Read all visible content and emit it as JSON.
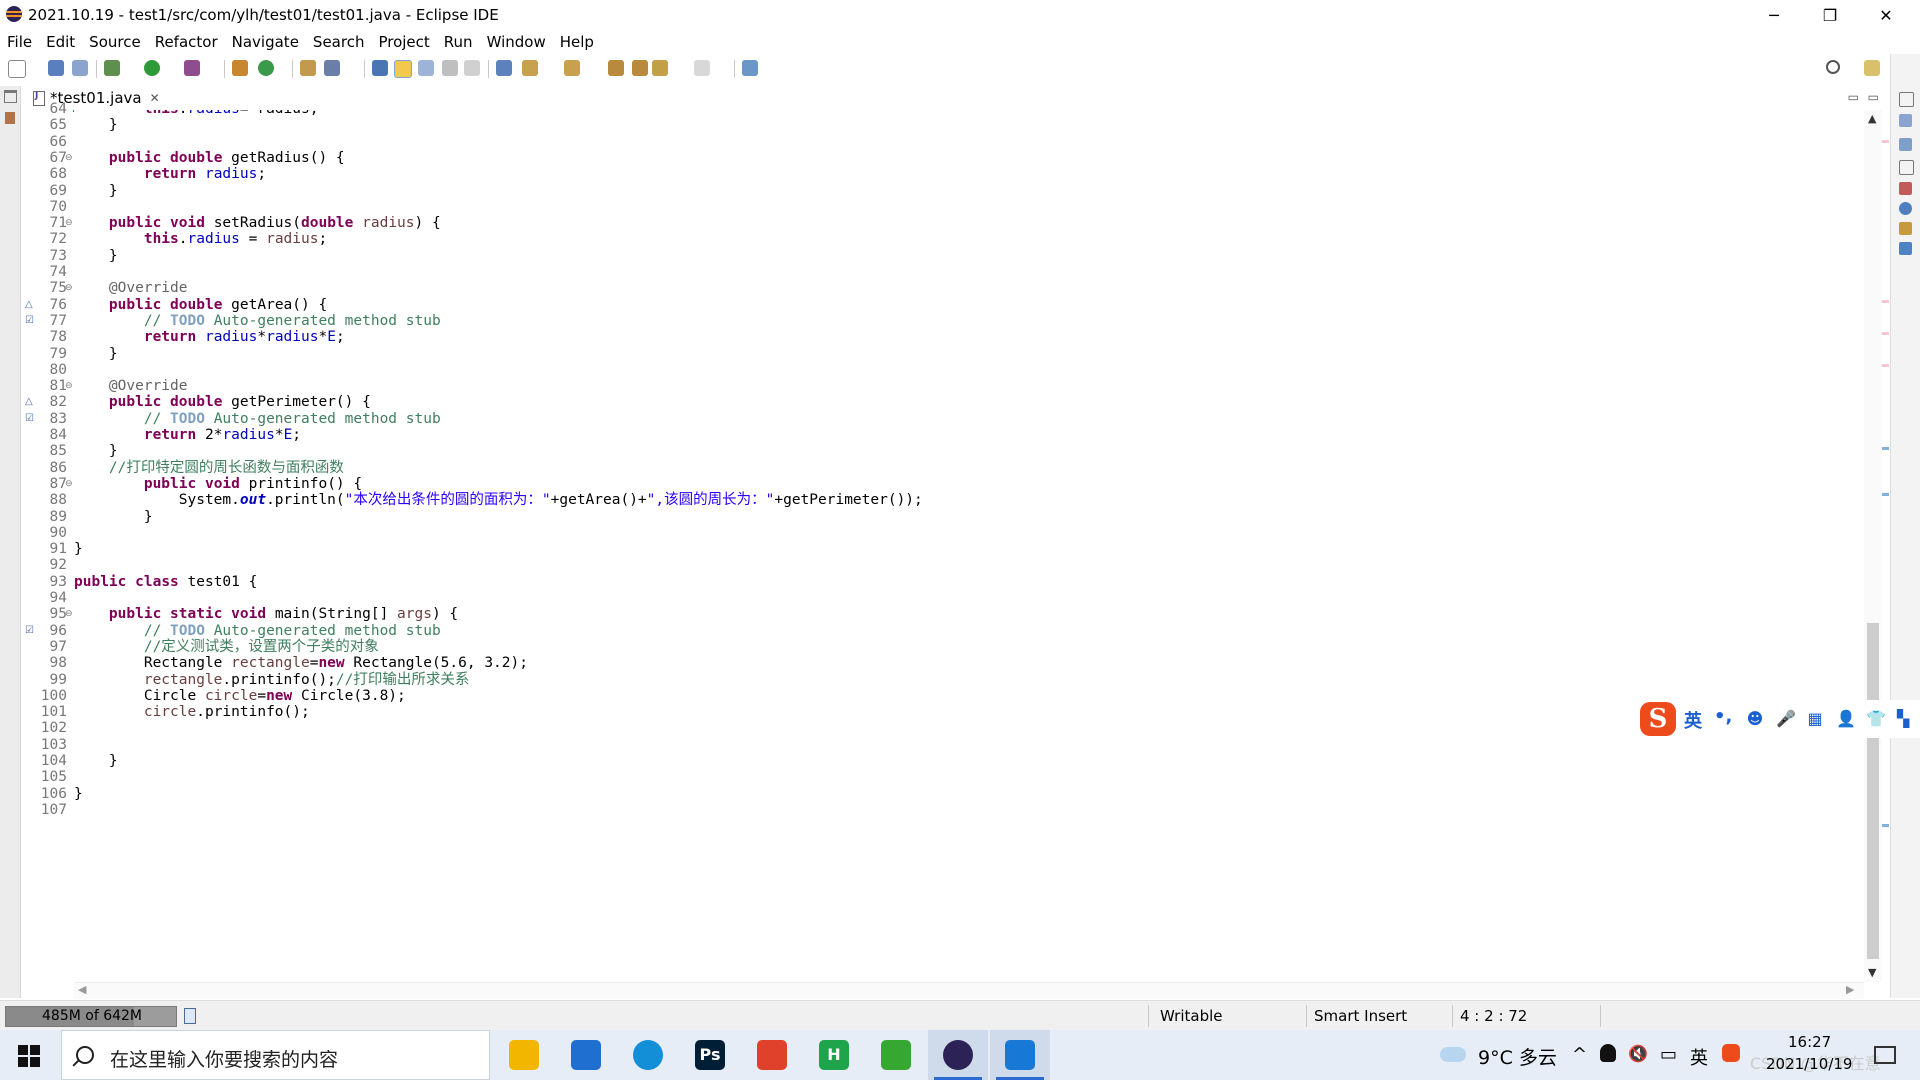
{
  "window": {
    "title": "2021.10.19 - test1/src/com/ylh/test01/test01.java - Eclipse IDE",
    "minimize_glyph": "─",
    "restore_glyph": "❐",
    "close_glyph": "✕"
  },
  "menu": [
    "File",
    "Edit",
    "Source",
    "Refactor",
    "Navigate",
    "Search",
    "Project",
    "Run",
    "Window",
    "Help"
  ],
  "editor": {
    "tab_label": "*test01.java",
    "tab_close_glyph": "✕",
    "minimize_glyph": "▭",
    "maximize_glyph": "▭"
  },
  "code_lines": [
    {
      "n": "64",
      "html": "        <span class=\"kw\">this</span>.<span class=\"fld\">radius</span>= radius;",
      "fold": false,
      "mark": ""
    },
    {
      "n": "65",
      "html": "    }",
      "fold": false,
      "mark": ""
    },
    {
      "n": "66",
      "html": "",
      "fold": false,
      "mark": ""
    },
    {
      "n": "67",
      "html": "    <span class=\"kw\">public</span> <span class=\"kw\">double</span> getRadius() {",
      "fold": true,
      "mark": ""
    },
    {
      "n": "68",
      "html": "        <span class=\"kw\">return</span> <span class=\"fld\">radius</span>;",
      "fold": false,
      "mark": ""
    },
    {
      "n": "69",
      "html": "    }",
      "fold": false,
      "mark": ""
    },
    {
      "n": "70",
      "html": "",
      "fold": false,
      "mark": ""
    },
    {
      "n": "71",
      "html": "    <span class=\"kw\">public</span> <span class=\"kw\">void</span> setRadius(<span class=\"kw\">double</span> <span class=\"lv\">radius</span>) {",
      "fold": true,
      "mark": ""
    },
    {
      "n": "72",
      "html": "        <span class=\"kw\">this</span>.<span class=\"fld\">radius</span> = <span class=\"lv\">radius</span>;",
      "fold": false,
      "mark": ""
    },
    {
      "n": "73",
      "html": "    }",
      "fold": false,
      "mark": ""
    },
    {
      "n": "74",
      "html": "",
      "fold": false,
      "mark": ""
    },
    {
      "n": "75",
      "html": "    <span class=\"an\">@Override</span>",
      "fold": true,
      "mark": ""
    },
    {
      "n": "76",
      "html": "    <span class=\"kw\">public</span> <span class=\"kw\">double</span> getArea() {",
      "fold": false,
      "mark": "override"
    },
    {
      "n": "77",
      "html": "        <span class=\"cm\">// </span><span class=\"tk\">TODO</span><span class=\"cm\"> Auto-generated method stub</span>",
      "fold": false,
      "mark": "task"
    },
    {
      "n": "78",
      "html": "        <span class=\"kw\">return</span> <span class=\"fld\">radius</span>*<span class=\"fld\">radius</span>*<span class=\"fld\">E</span>;",
      "fold": false,
      "mark": ""
    },
    {
      "n": "79",
      "html": "    }",
      "fold": false,
      "mark": ""
    },
    {
      "n": "80",
      "html": "",
      "fold": false,
      "mark": ""
    },
    {
      "n": "81",
      "html": "    <span class=\"an\">@Override</span>",
      "fold": true,
      "mark": ""
    },
    {
      "n": "82",
      "html": "    <span class=\"kw\">public</span> <span class=\"kw\">double</span> getPerimeter() {",
      "fold": false,
      "mark": "override"
    },
    {
      "n": "83",
      "html": "        <span class=\"cm\">// </span><span class=\"tk\">TODO</span><span class=\"cm\"> Auto-generated method stub</span>",
      "fold": false,
      "mark": "task"
    },
    {
      "n": "84",
      "html": "        <span class=\"kw\">return</span> 2*<span class=\"fld\">radius</span>*<span class=\"fld\">E</span>;",
      "fold": false,
      "mark": ""
    },
    {
      "n": "85",
      "html": "    }",
      "fold": false,
      "mark": ""
    },
    {
      "n": "86",
      "html": "    <span class=\"cm\">//打印特定圆的周长函数与面积函数</span>",
      "fold": false,
      "mark": ""
    },
    {
      "n": "87",
      "html": "        <span class=\"kw\">public</span> <span class=\"kw\">void</span> printinfo() {",
      "fold": true,
      "mark": ""
    },
    {
      "n": "88",
      "html": "            System.<span class=\"sf\">out</span>.println(<span class=\"st\">\"本次给出条件的圆的面积为：\"</span>+getArea()+<span class=\"st\">\",该圆的周长为：\"</span>+getPerimeter());",
      "fold": false,
      "mark": ""
    },
    {
      "n": "89",
      "html": "        }",
      "fold": false,
      "mark": ""
    },
    {
      "n": "90",
      "html": "",
      "fold": false,
      "mark": ""
    },
    {
      "n": "91",
      "html": "}",
      "fold": false,
      "mark": ""
    },
    {
      "n": "92",
      "html": "",
      "fold": false,
      "mark": ""
    },
    {
      "n": "93",
      "html": "<span class=\"kw\">public</span> <span class=\"kw\">class</span> test01 {",
      "fold": false,
      "mark": ""
    },
    {
      "n": "94",
      "html": "",
      "fold": false,
      "mark": ""
    },
    {
      "n": "95",
      "html": "    <span class=\"kw\">public</span> <span class=\"kw\">static</span> <span class=\"kw\">void</span> main(String[] <span class=\"lv\">args</span>) {",
      "fold": true,
      "mark": ""
    },
    {
      "n": "96",
      "html": "        <span class=\"cm\">// </span><span class=\"tk\">TODO</span><span class=\"cm\"> Auto-generated method stub</span>",
      "fold": false,
      "mark": "task"
    },
    {
      "n": "97",
      "html": "        <span class=\"cm\">//定义测试类，设置两个子类的对象</span>",
      "fold": false,
      "mark": ""
    },
    {
      "n": "98",
      "html": "        Rectangle <span class=\"lv\">rectangle</span>=<span class=\"kw\">new</span> Rectangle(5.6, 3.2);",
      "fold": false,
      "mark": ""
    },
    {
      "n": "99",
      "html": "        <span class=\"lv\">rectangle</span>.printinfo();<span class=\"cm\">//打印输出所求关系</span>",
      "fold": false,
      "mark": ""
    },
    {
      "n": "100",
      "html": "        Circle <span class=\"lv\">circle</span>=<span class=\"kw\">new</span> Circle(3.8);",
      "fold": false,
      "mark": ""
    },
    {
      "n": "101",
      "html": "        <span class=\"lv\">circle</span>.printinfo();",
      "fold": false,
      "mark": ""
    },
    {
      "n": "102",
      "html": "",
      "fold": false,
      "mark": ""
    },
    {
      "n": "103",
      "html": "",
      "fold": false,
      "mark": ""
    },
    {
      "n": "104",
      "html": "    }",
      "fold": false,
      "mark": ""
    },
    {
      "n": "105",
      "html": "",
      "fold": false,
      "mark": ""
    },
    {
      "n": "106",
      "html": "}",
      "fold": false,
      "mark": ""
    },
    {
      "n": "107",
      "html": "",
      "fold": false,
      "mark": ""
    }
  ],
  "status": {
    "heap": "485M of 642M",
    "heap_used_fraction": 0.755,
    "writable": "Writable",
    "insert_mode": "Smart Insert",
    "position": "4 : 2 : 72"
  },
  "ime": {
    "logo": "S",
    "lang": "英",
    "punct": "•,",
    "icons": [
      "emoji-icon",
      "mic-icon",
      "keyboard-icon",
      "user-icon",
      "skin-icon",
      "grid-icon"
    ]
  },
  "taskbar": {
    "search_placeholder": "在这里输入你要搜索的内容",
    "apps": [
      {
        "name": "taskbar-file-explorer",
        "label": "",
        "color": "#f2b600"
      },
      {
        "name": "taskbar-mail",
        "label": "",
        "color": "#1f6fd1"
      },
      {
        "name": "taskbar-edge",
        "label": "",
        "color": "#138fd8"
      },
      {
        "name": "taskbar-photoshop",
        "label": "Ps",
        "color": "#001e36"
      },
      {
        "name": "taskbar-office",
        "label": "",
        "color": "#e0412a"
      },
      {
        "name": "taskbar-hbuilder",
        "label": "H",
        "color": "#1ea54b"
      },
      {
        "name": "taskbar-green-app",
        "label": "",
        "color": "#36a832"
      },
      {
        "name": "taskbar-eclipse",
        "label": "",
        "color": "#2c2255"
      },
      {
        "name": "taskbar-phone-app",
        "label": "",
        "color": "#1878d6"
      }
    ],
    "weather": "9°C  多云",
    "tray": {
      "chevron": "^",
      "volume": "🔇",
      "battery": "▭",
      "ime": "英"
    },
    "clock_time": "16:27",
    "clock_date": "2021/10/19",
    "watermark": "CSDN @华不在意"
  },
  "colors": {
    "keyword": "#7f0055",
    "field": "#0000c0",
    "comment": "#3f7f5f",
    "string": "#2a00ff",
    "accent": "#2b6cd4"
  }
}
